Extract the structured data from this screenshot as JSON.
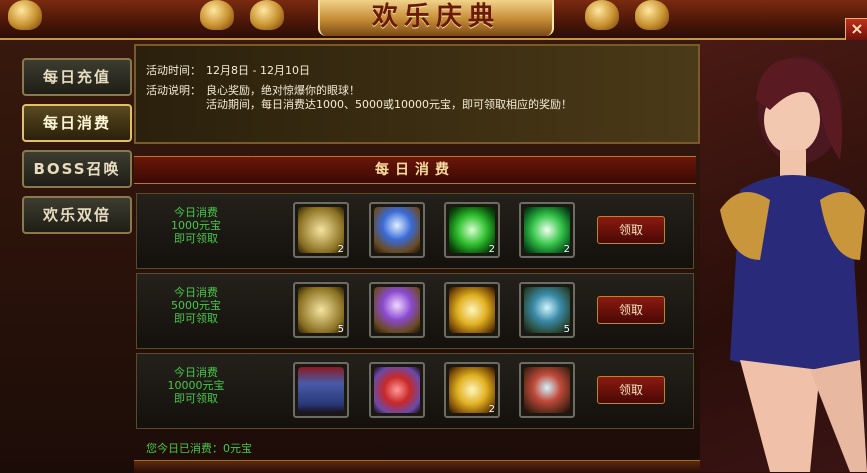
{
  "window": {
    "title": "欢乐庆典",
    "close_label": "×"
  },
  "side_menu": {
    "items": [
      {
        "label": "每日充值",
        "active": false
      },
      {
        "label": "每日消费",
        "active": true
      },
      {
        "label": "BOSS召唤",
        "active": false
      },
      {
        "label": "欢乐双倍",
        "active": false
      }
    ]
  },
  "info": {
    "time_label": "活动时间：",
    "time_value": "12月8日 - 12月10日",
    "desc_label": "活动说明：",
    "desc_line1": "良心奖励，绝对惊爆你的眼球！",
    "desc_line2": "活动期间，每日消费达1000、5000或10000元宝，即可领取相应的奖励！"
  },
  "section": {
    "title": "每日消费"
  },
  "tiers": [
    {
      "line1": "今日消费",
      "line2": "1000元宝",
      "line3": "即可领取",
      "button": "领取",
      "items": [
        {
          "icon": "scroll-fragments-icon",
          "count": "2",
          "color": "#d8c070"
        },
        {
          "icon": "magic-chest-icon",
          "count": "",
          "color": "#3a6ad8"
        },
        {
          "icon": "green-orb-icon",
          "count": "2",
          "color": "#2fbf2f"
        },
        {
          "icon": "green-spiral-orb-icon",
          "count": "2",
          "color": "#37c64a"
        }
      ]
    },
    {
      "line1": "今日消费",
      "line2": "5000元宝",
      "line3": "即可领取",
      "button": "领取",
      "items": [
        {
          "icon": "scroll-fragments-icon",
          "count": "5",
          "color": "#d8c070"
        },
        {
          "icon": "purple-chest-icon",
          "count": "",
          "color": "#8a4ad0"
        },
        {
          "icon": "gold-orb-icon",
          "count": "",
          "color": "#e0b020"
        },
        {
          "icon": "jeweled-crown-icon",
          "count": "5",
          "color": "#3a8aa8"
        }
      ]
    },
    {
      "line1": "今日消费",
      "line2": "10000元宝",
      "line3": "即可领取",
      "button": "领取",
      "items": [
        {
          "icon": "mystic-robe-icon",
          "count": "",
          "color": "#4a5aa8"
        },
        {
          "icon": "gift-box-icon",
          "count": "",
          "color": "#c82828"
        },
        {
          "icon": "gold-orb-icon",
          "count": "2",
          "color": "#e0b020"
        },
        {
          "icon": "jeweled-crown-icon",
          "count": "",
          "color": "#c04a3a"
        }
      ]
    }
  ],
  "footer": {
    "spent_text": "您今日已消费：0元宝"
  },
  "colors": {
    "green_text": "#49c64a",
    "gold": "#c9963c"
  }
}
